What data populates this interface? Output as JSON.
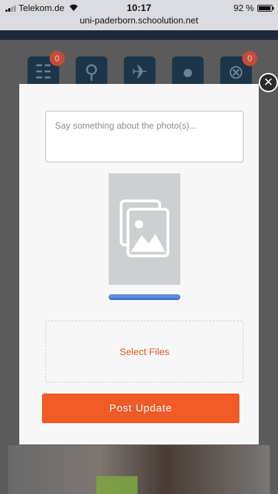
{
  "status_bar": {
    "carrier": "Telekom.de",
    "time": "10:17",
    "url": "uni-paderborn.schoolution.net",
    "battery": "92 %",
    "battery_level": 0.92
  },
  "nav": {
    "items": [
      {
        "icon": "checklist-icon",
        "glyph": "☷",
        "badge": "0"
      },
      {
        "icon": "location-pin-icon",
        "glyph": "⚲",
        "badge": ""
      },
      {
        "icon": "running-icon",
        "glyph": "✈",
        "badge": ""
      },
      {
        "icon": "chat-bubble-icon",
        "glyph": "●",
        "badge": ""
      },
      {
        "icon": "share-icon",
        "glyph": "⊗",
        "badge": "0"
      }
    ]
  },
  "modal": {
    "caption_placeholder": "Say something about the photo(s)...",
    "caption_value": "",
    "preview_icon": "photos-icon",
    "upload_progress": 1.0,
    "select_files_label": "Select Files",
    "post_button_label": "Post Update",
    "close_icon": "close-icon"
  },
  "colors": {
    "accent": "#ef5a26",
    "progress": "#3e72d6"
  }
}
